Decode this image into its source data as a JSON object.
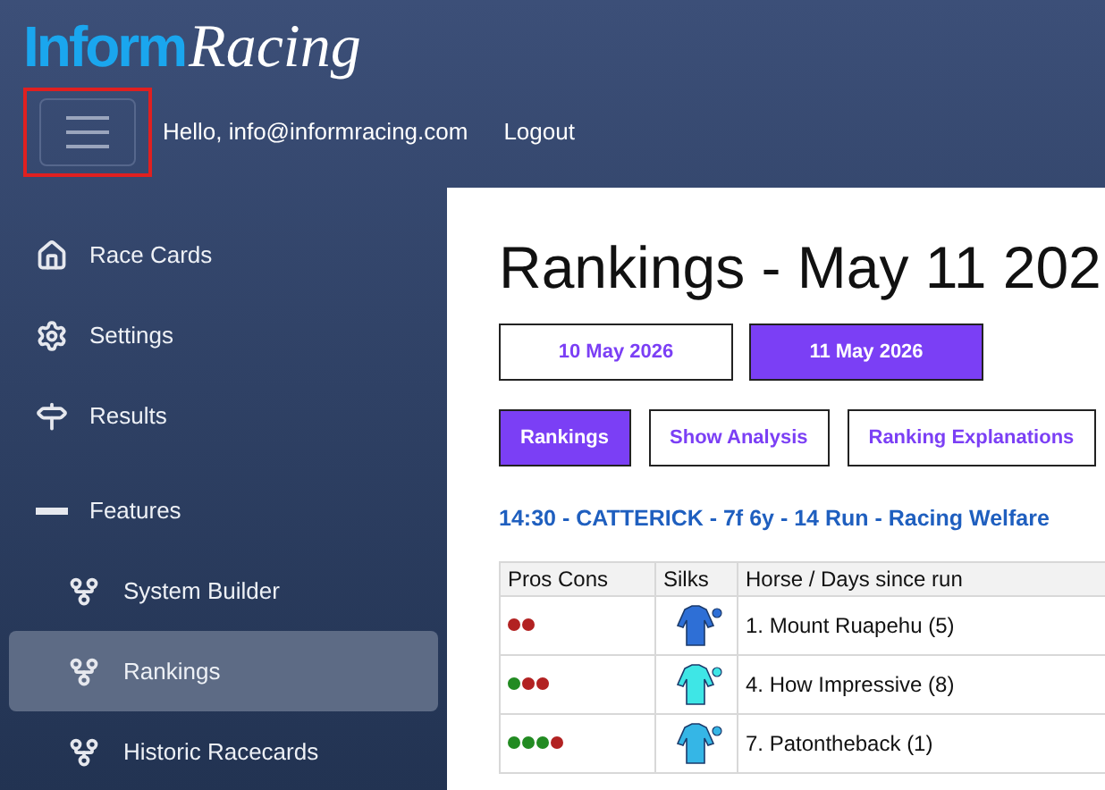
{
  "logo": {
    "part_1": "Inform",
    "part_2": "Racing"
  },
  "header": {
    "greeting": "Hello, info@informracing.com",
    "logout": "Logout"
  },
  "sidebar": {
    "items": [
      {
        "label": "Race Cards",
        "selected": false
      },
      {
        "label": "Settings",
        "selected": false
      },
      {
        "label": "Results",
        "selected": false
      },
      {
        "label": "Features",
        "selected": false,
        "expanded": true,
        "children": [
          {
            "label": "System Builder",
            "selected": false
          },
          {
            "label": "Rankings",
            "selected": true
          },
          {
            "label": "Historic Racecards",
            "selected": false
          }
        ]
      }
    ]
  },
  "title": "Rankings - May 11 202",
  "date_tabs": [
    {
      "label": "10 May 2026",
      "selected": false
    },
    {
      "label": "11 May 2026",
      "selected": true
    }
  ],
  "view_tabs": [
    {
      "label": "Rankings",
      "selected": true
    },
    {
      "label": "Show Analysis",
      "selected": false
    },
    {
      "label": "Ranking Explanations",
      "selected": false
    }
  ],
  "race_heading": "14:30 - CATTERICK - 7f 6y - 14 Run - Racing Welfare",
  "table": {
    "columns": [
      "Pros Cons",
      "Silks",
      "Horse / Days since run"
    ],
    "rows": [
      {
        "pros_cons": [
          {
            "color": "#b22222"
          },
          {
            "color": "#b22222"
          }
        ],
        "color": "#2e6fd6",
        "horse": "1. Mount Ruapehu (5)"
      },
      {
        "pros_cons": [
          {
            "color": "#228b22"
          },
          {
            "color": "#b22222"
          },
          {
            "color": "#b22222"
          }
        ],
        "color": "#3ee6e6",
        "horse": "4. How Impressive (8)"
      },
      {
        "pros_cons": [
          {
            "color": "#228b22"
          },
          {
            "color": "#228b22"
          },
          {
            "color": "#228b22"
          },
          {
            "color": "#b22222"
          }
        ],
        "color": "#35b6e6",
        "horse": "7. Patontheback (1)"
      }
    ]
  }
}
